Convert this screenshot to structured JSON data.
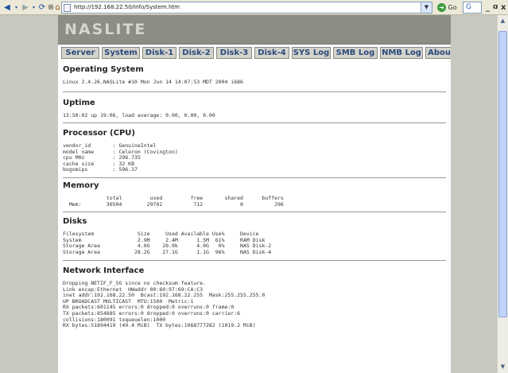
{
  "browser": {
    "url": "http://192.168.22.50/Info/System.htm",
    "go_label": "Go",
    "search_label": "G"
  },
  "logo": "NASLITE",
  "nav": [
    "Server",
    "System",
    "Disk-1",
    "Disk-2",
    "Disk-3",
    "Disk-4",
    "SYS Log",
    "SMB Log",
    "NMB Log",
    "About"
  ],
  "sections": {
    "os": {
      "title": "Operating System",
      "body": "Linux 2.4.26.NASLite #10 Mon Jun 14 14:07:53 MDT 2004 i686"
    },
    "uptime": {
      "title": "Uptime",
      "body": "13:50:02 up 19:06, load average: 0.00, 0.00, 0.00"
    },
    "cpu": {
      "title": "Processor (CPU)",
      "body": "vendor_id       : GenuineIntel\nmodel name      : Celeron (Covington)\ncpu MHz         : 298.735\ncache size      : 32 KB\nbogomips        : 596.37"
    },
    "memory": {
      "title": "Memory",
      "body": "              total         used         free       shared      buffers\n  Mem:        30504        29792          712            0          296"
    },
    "disks": {
      "title": "Disks",
      "body": "Filesystem              Size     Used Available Use%     Device\nSystem                  2.9M     2.4M      1.5M  61%     RAM Disk\nStorage Area            4.0G    20.0k      4.0G   0%     NAS Disk-2\nStorage Area           28.2G    27.1G      1.1G  96%     NAS Disk-4"
    },
    "network": {
      "title": "Network Interface",
      "body": "Dropping NETIF_F_SG since no checksum feature.\nLink encap:Ethernet  HWaddr 00:60:97:69:CA:C3\ninet addr:192.168.22.50  Bcast:192.168.22.255  Mask:255.255.255.0\nUP BROADCAST MULTICAST  MTU:1500  Metric:1\nRX packets:601145 errors:0 dropped:0 overruns:0 frame:0\nTX packets:854885 errors:0 dropped:0 overruns:0 carrier:6\ncollisions:180091 txqueuelen:1000\nRX bytes:51894419 (49.4 MiB)  TX bytes:1068777282 (1019.2 MiB)"
    }
  }
}
